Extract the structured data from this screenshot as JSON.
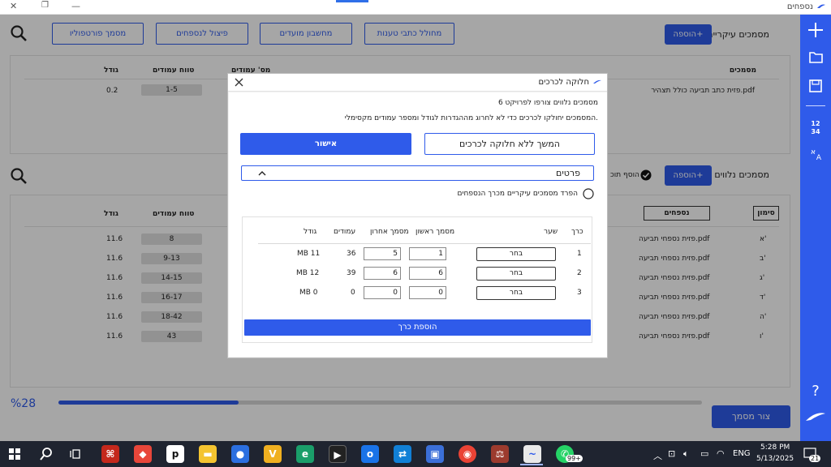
{
  "window": {
    "title": "נספחים",
    "close": "✕",
    "restore": "❐",
    "minimize": "—"
  },
  "main_section": {
    "title": "מסמכים עיקריים",
    "add_button": "הוספה+",
    "toolbar": [
      "מחולל כתבי טענות",
      "מחשבון מועדים",
      "פיצול לנספחים",
      "מסמך פורטפוליו"
    ],
    "columns": {
      "documents": "מסמכים",
      "pages": "מס' עמודים",
      "range": "טווח עמודים",
      "size": "גודל"
    },
    "rows": [
      {
        "name": "פזית כתב תביעה כולל תצהיר.pdf",
        "range": "1-5",
        "size": "0.2"
      }
    ]
  },
  "annex_section": {
    "title": "מסמכים נלווים",
    "add_button": "הוספה+",
    "add_check_label": "הוסף תוכ",
    "columns": {
      "marker": "סימון",
      "annexes": "נספחים",
      "range": "טווח עמודים",
      "size": "גודל"
    },
    "rows": [
      {
        "marker": "א'",
        "name": "פזית נספחי תביעה.pdf",
        "range": "8",
        "size": "11.6"
      },
      {
        "marker": "ב'",
        "name": "פזית נספחי תביעה.pdf",
        "range": "9-13",
        "size": "11.6"
      },
      {
        "marker": "ג'",
        "name": "פזית נספחי תביעה.pdf",
        "range": "14-15",
        "size": "11.6"
      },
      {
        "marker": "ד'",
        "name": "פזית נספחי תביעה.pdf",
        "range": "16-17",
        "size": "11.6"
      },
      {
        "marker": "ה'",
        "name": "פזית נספחי תביעה.pdf",
        "range": "18-42",
        "size": "11.6"
      },
      {
        "marker": "ו'",
        "name": "פזית נספחי תביעה.pdf",
        "range": "43",
        "size": "11.6"
      }
    ]
  },
  "progress": {
    "label": "%28",
    "value": 0.28
  },
  "create_button": "צור מסמך",
  "modal": {
    "title": "חלוקה לכרכים",
    "line1": "6 מסמכים נלווים צורפו לפרויקט",
    "line2": "המסמכים יחולקו לכרכים כדי לא לחרוג מההגדרות לגודל ומספר עמודים מקסימלי.",
    "confirm": "אישור",
    "continue_without": "המשך ללא חלוקה לכרכים",
    "details": "פרטים",
    "separate_label": "הפרד מסמכים עיקריים מכרך הנספחים",
    "columns": {
      "volume": "כרך",
      "cover": "שער",
      "first_doc": "מסמך ראשון",
      "last_doc": "מסמך אחרון",
      "pages": "עמודים",
      "size": "גודל"
    },
    "choose_label": "בחר",
    "rows": [
      {
        "volume": "1",
        "first": "1",
        "last": "5",
        "pages": "36",
        "size": "MB 11"
      },
      {
        "volume": "2",
        "first": "6",
        "last": "6",
        "pages": "39",
        "size": "MB 12"
      },
      {
        "volume": "3",
        "first": "0",
        "last": "0",
        "pages": "0",
        "size": "MB 0"
      }
    ],
    "add_volume": "הוספת כרך"
  },
  "taskbar": {
    "lang": "ENG",
    "time": "5:28 PM",
    "date": "5/13/2025",
    "whatsapp_badge": "99+",
    "notif_count": "21"
  },
  "colors": {
    "accent": "#2f5bea",
    "taskbar": "#1f2430"
  }
}
